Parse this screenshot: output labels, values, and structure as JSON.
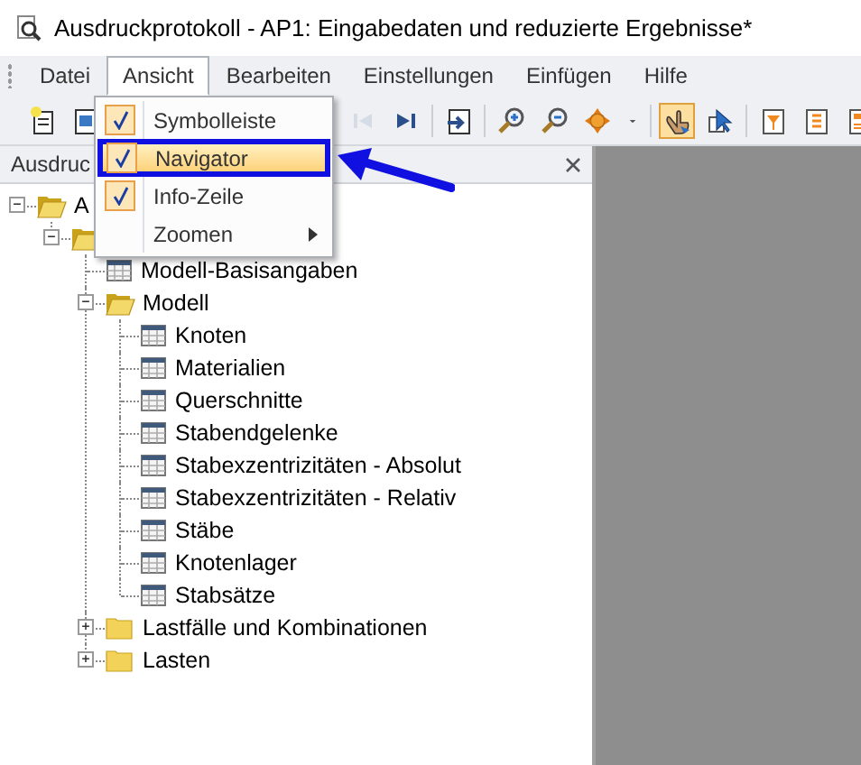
{
  "window": {
    "title": "Ausdruckprotokoll - AP1: Eingabedaten und reduzierte Ergebnisse*"
  },
  "menu_bar": [
    {
      "label": "Datei",
      "selected": false
    },
    {
      "label": "Ansicht",
      "selected": true
    },
    {
      "label": "Bearbeiten",
      "selected": false
    },
    {
      "label": "Einstellungen",
      "selected": false
    },
    {
      "label": "Einfügen",
      "selected": false
    },
    {
      "label": "Hilfe",
      "selected": false
    }
  ],
  "dropdown": [
    {
      "label": "Symbolleiste",
      "checked": true,
      "highlighted": false,
      "submenu": false
    },
    {
      "label": "Navigator",
      "checked": true,
      "highlighted": true,
      "submenu": false
    },
    {
      "label": "Info-Zeile",
      "checked": true,
      "highlighted": false,
      "submenu": false
    },
    {
      "label": "Zoomen",
      "checked": false,
      "highlighted": false,
      "submenu": true
    }
  ],
  "toolbar": {
    "left": [
      {
        "kind": "new-page",
        "selected": false,
        "disabled": false
      },
      {
        "kind": "image-page",
        "selected": false,
        "disabled": false
      }
    ],
    "right": [
      {
        "kind": "first",
        "selected": false,
        "disabled": true
      },
      {
        "kind": "last",
        "selected": false,
        "disabled": false
      },
      {
        "kind": "export",
        "selected": false,
        "disabled": false
      },
      {
        "kind": "zoom-in",
        "selected": false,
        "disabled": false
      },
      {
        "kind": "zoom-out",
        "selected": false,
        "disabled": false
      },
      {
        "kind": "move",
        "selected": false,
        "disabled": false
      },
      {
        "kind": "dropdown",
        "selected": false,
        "disabled": false
      },
      {
        "kind": "hand",
        "selected": true,
        "disabled": false
      },
      {
        "kind": "pointer",
        "selected": false,
        "disabled": false
      },
      {
        "kind": "filter-page",
        "selected": false,
        "disabled": false
      },
      {
        "kind": "list-page",
        "selected": false,
        "disabled": false
      },
      {
        "kind": "orange-page",
        "selected": false,
        "disabled": false
      }
    ]
  },
  "navigator": {
    "title": "Ausdruc",
    "tree": [
      {
        "label": "A",
        "kind": "folder",
        "expanded": true,
        "children": [
          {
            "kind": "folder",
            "expanded": true,
            "children": [
              {
                "label": "Modell-Basisangaben",
                "kind": "table"
              },
              {
                "label": "Modell",
                "kind": "folder",
                "expanded": true,
                "children": [
                  {
                    "label": "Knoten",
                    "kind": "table"
                  },
                  {
                    "label": "Materialien",
                    "kind": "table"
                  },
                  {
                    "label": "Querschnitte",
                    "kind": "table"
                  },
                  {
                    "label": "Stabendgelenke",
                    "kind": "table"
                  },
                  {
                    "label": "Stabexzentrizitäten - Absolut",
                    "kind": "table"
                  },
                  {
                    "label": "Stabexzentrizitäten - Relativ",
                    "kind": "table"
                  },
                  {
                    "label": "Stäbe",
                    "kind": "table"
                  },
                  {
                    "label": "Knotenlager",
                    "kind": "table"
                  },
                  {
                    "label": "Stabsätze",
                    "kind": "table"
                  }
                ]
              },
              {
                "label": "Lastfälle und Kombinationen",
                "kind": "folder",
                "expanded": false
              },
              {
                "label": "Lasten",
                "kind": "folder",
                "expanded": false
              }
            ]
          }
        ]
      }
    ]
  }
}
